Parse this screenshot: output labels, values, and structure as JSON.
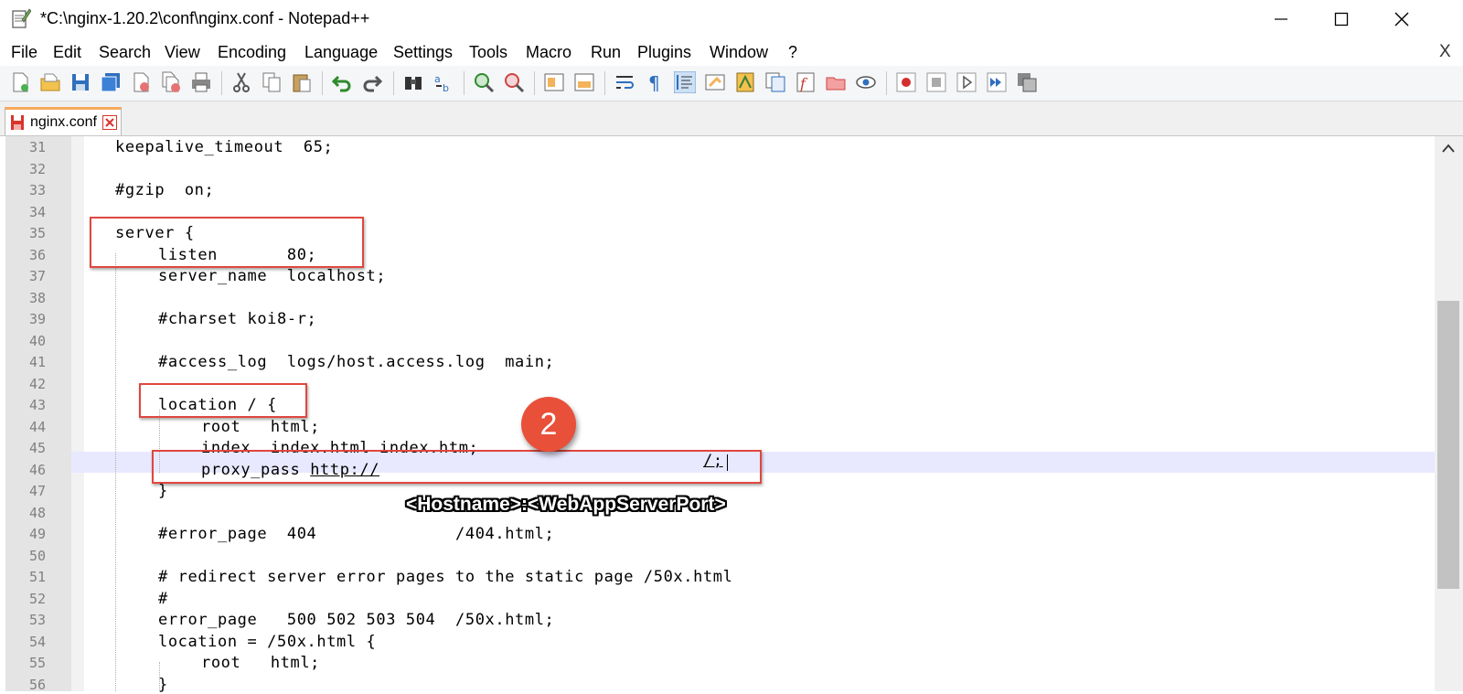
{
  "window": {
    "title": "*C:\\nginx-1.20.2\\conf\\nginx.conf - Notepad++",
    "controls": {
      "minimize": "—",
      "maximize": "☐",
      "close": "✕"
    }
  },
  "menu": {
    "items": [
      "File",
      "Edit",
      "Search",
      "View",
      "Encoding",
      "Language",
      "Settings",
      "Tools",
      "Macro",
      "Run",
      "Plugins",
      "Window",
      "?"
    ],
    "close_label": "X"
  },
  "toolbar": {
    "icons": [
      "new-file-icon",
      "open-file-icon",
      "save-icon",
      "save-all-icon",
      "close-icon",
      "close-all-icon",
      "print-icon",
      "cut-icon",
      "copy-icon",
      "paste-icon",
      "undo-icon",
      "redo-icon",
      "find-icon",
      "replace-icon",
      "zoom-in-icon",
      "zoom-out-icon",
      "sync-vertical-icon",
      "sync-horizontal-icon",
      "word-wrap-icon",
      "show-all-chars-icon",
      "indent-guide-icon",
      "udl-icon",
      "doc-map-icon",
      "doc-list-icon",
      "function-list-icon",
      "folder-workspace-icon",
      "monitoring-icon",
      "record-macro-icon",
      "stop-record-icon",
      "play-macro-icon",
      "run-macro-multiple-icon",
      "save-macro-icon"
    ]
  },
  "tab": {
    "label": "nginx.conf"
  },
  "editor": {
    "lines": [
      {
        "num": "31",
        "text": "keepalive_timeout  65;",
        "indent": 0
      },
      {
        "num": "32",
        "text": "",
        "indent": 0
      },
      {
        "num": "33",
        "text": "#gzip  on;",
        "indent": 0
      },
      {
        "num": "34",
        "text": "",
        "indent": 0
      },
      {
        "num": "35",
        "text": "server {",
        "indent": 0
      },
      {
        "num": "36",
        "text": "listen       80;",
        "indent": 1
      },
      {
        "num": "37",
        "text": "server_name  localhost;",
        "indent": 1
      },
      {
        "num": "38",
        "text": "",
        "indent": 1
      },
      {
        "num": "39",
        "text": "#charset koi8-r;",
        "indent": 1
      },
      {
        "num": "40",
        "text": "",
        "indent": 1
      },
      {
        "num": "41",
        "text": "#access_log  logs/host.access.log  main;",
        "indent": 1
      },
      {
        "num": "42",
        "text": "",
        "indent": 1
      },
      {
        "num": "43",
        "text": "location / {",
        "indent": 1
      },
      {
        "num": "44",
        "text": "root   html;",
        "indent": 2
      },
      {
        "num": "45",
        "text": "index  index.html index.htm;",
        "indent": 2
      },
      {
        "num": "46",
        "text": "proxy_pass http://",
        "indent": 2
      },
      {
        "num": "47",
        "text": "}",
        "indent": 1
      },
      {
        "num": "48",
        "text": "",
        "indent": 1
      },
      {
        "num": "49",
        "text": "#error_page  404              /404.html;",
        "indent": 1
      },
      {
        "num": "50",
        "text": "",
        "indent": 1
      },
      {
        "num": "51",
        "text": "# redirect server error pages to the static page /50x.html",
        "indent": 1
      },
      {
        "num": "52",
        "text": "#",
        "indent": 1
      },
      {
        "num": "53",
        "text": "error_page   500 502 503 504  /50x.html;",
        "indent": 1
      },
      {
        "num": "54",
        "text": "location = /50x.html {",
        "indent": 1
      },
      {
        "num": "55",
        "text": "root   html;",
        "indent": 2
      },
      {
        "num": "56",
        "text": "}",
        "indent": 1
      }
    ],
    "line46_suffix": "/;"
  },
  "annotation": {
    "badge": "2",
    "callout": "<Hostname>:<WebAppServerPort>"
  },
  "colors": {
    "highlight_box": "#e0473f",
    "badge": "#e8503a",
    "current_line": "#e8e8ff"
  }
}
